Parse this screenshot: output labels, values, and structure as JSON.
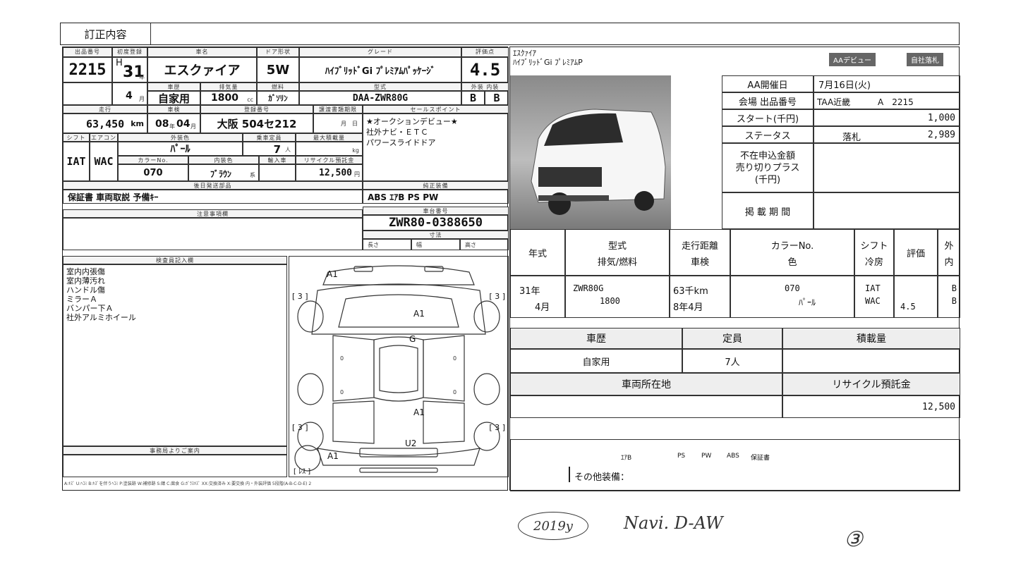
{
  "correction": {
    "label": "訂正内容",
    "value": ""
  },
  "sheet": {
    "lot_no_label": "出品番号",
    "lot_no": "2215",
    "first_reg_label": "初度登録",
    "era": "H",
    "year": "31",
    "year_unit": "年",
    "month": "4",
    "month_unit": "月",
    "car_name_label": "車名",
    "car_name": "エスクァイア",
    "door_label": "ドア形状",
    "door": "5W",
    "grade_label": "グレード",
    "grade": "ﾊｲﾌﾞﾘｯﾄﾞGi ﾌﾟﾚﾐｱﾑﾊﾟｯｹｰｼﾞ",
    "score_label": "評価点",
    "score": "4.5",
    "ext_int_label": "外装 内装",
    "ext_grade": "B",
    "int_grade": "B",
    "history_label": "車歴",
    "history": "自家用",
    "displacement_label": "排気量",
    "displacement": "1800",
    "cc": "cc",
    "fuel_label": "燃料",
    "fuel": "ｶﾞｿﾘﾝ",
    "model_label": "型式",
    "model": "DAA-ZWR80G",
    "mileage_label": "走行",
    "mileage": "63,450",
    "km": "km",
    "inspection_label": "車検",
    "inspection": "08",
    "insp_year_unit": "年",
    "inspection_m": "04",
    "insp_month_unit": "月",
    "plate_label": "登録番号",
    "plate": "大阪 504セ212",
    "doc_expiry_label": "譲渡書類期限",
    "doc_expiry": "月　日",
    "sales_point_label": "セールスポイント",
    "sales_points": [
      "★オークションデビュー★",
      "社外ナビ・ＥＴＣ",
      "パワースライドドア"
    ],
    "shift_label": "シフト",
    "shift": "IAT",
    "ac_label": "エアコン",
    "ac": "WAC",
    "ext_color_label": "外装色",
    "ext_color": "ﾊﾟｰﾙ",
    "capacity_label": "乗車定員",
    "capacity": "7",
    "capacity_unit": "人",
    "max_load_label": "最大積載量",
    "max_load_unit": "kg",
    "color_no_label": "カラーNo.",
    "color_no": "070",
    "int_color_label": "内装色",
    "int_color": "ﾌﾞﾗｳﾝ",
    "int_color_unit": "系",
    "import_label": "輸入車",
    "recycle_label": "リサイクル預託金",
    "recycle": "12,500",
    "recycle_unit": "円",
    "parts_label": "後日発送部品",
    "parts": "保証書 車両取説 予備ｷｰ",
    "std_equip_label": "純正装備",
    "std_equip": "ABS ｴｱB PS PW",
    "notes_label": "注意事項欄",
    "chassis_label": "車台番号",
    "chassis": "ZWR80-0388650",
    "dims_label": "寸法",
    "len_label": "長さ",
    "width_label": "幅",
    "height_label": "高さ",
    "inspector_label": "検査員記入欄",
    "inspector_notes": [
      "室内内張傷",
      "室内薄汚れ",
      "ハンドル傷",
      "ミラーＡ",
      "バンパー下Ａ",
      "社外アルミホイール"
    ],
    "office_label": "事務局よりご案内",
    "legend": "A:ｷｽﾞ U:ﾍｺﾐ B:ｷｽﾞを伴うﾍｺﾐ P:塗装跡 W:補修跡 S:錆 C:腐食 G:ｶﾞﾗｽｷｽﾞ XX:交換済み X:要交換 内・外装評価 5段階(A-B-C-D-E) 2"
  },
  "diagram": {
    "a1_tl": "A1",
    "a1_mid": "A1",
    "g": "G",
    "a1_rear": "A1",
    "u2": "U2",
    "a1_bl": "A1",
    "b3_tl": "[ 3 ]",
    "b3_tr": "[ 3 ]",
    "b3_bl": "[ 3 ]",
    "b3_br": "[ 3 ]",
    "zero": "0",
    "spare": "[ ﾚｽ ]"
  },
  "summary": {
    "title_line1": "ｴｽｸｧｲｱ",
    "title_line2": "ﾊｲﾌﾞﾘｯﾄﾞGi ﾌﾟﾚﾐｱﾑP",
    "badge1": "AAデビュー",
    "badge2": "自社落札",
    "rows": [
      {
        "label": "AA開催日",
        "value": "7月16日(火)"
      },
      {
        "label": "会場 出品番号",
        "venue": "TAA近畿",
        "value": "A　2215"
      },
      {
        "label": "スタート(千円)",
        "value": "1,000"
      },
      {
        "label": "ステータス",
        "status": "落札",
        "value": "2,989"
      },
      {
        "label": "不在申込金額\n売り切りプラス\n(千円)",
        "value": ""
      },
      {
        "label": "掲 載 期 間",
        "value": ""
      }
    ],
    "spec_headers": {
      "year": "年式",
      "model": "型式",
      "model2": "排気/燃料",
      "mileage": "走行距離",
      "mileage2": "車検",
      "color": "カラーNo.",
      "color2": "色",
      "shift": "シフト",
      "shift2": "冷房",
      "score": "評価",
      "ext": "外",
      "int": "内"
    },
    "spec_values": {
      "year": "31年",
      "month": "4月",
      "model": "ZWR80G",
      "cc": "1800",
      "km": "63千km",
      "insp": "8年4月",
      "color_no": "070",
      "color": "ﾊﾟｰﾙ",
      "shift": "IAT",
      "ac": "WAC",
      "score": "4.5",
      "ext": "B",
      "int": "B"
    },
    "history_h": "車歴",
    "capacity_h": "定員",
    "load_h": "積載量",
    "history_v": "自家用",
    "capacity_v": "7人",
    "load_v": "",
    "location_h": "車両所在地",
    "recycle_h": "リサイクル預託金",
    "location_v": "",
    "recycle_v": "12,500",
    "equip": [
      "ｴｱB",
      "PS",
      "PW",
      "ABS",
      "保証書"
    ],
    "other_label": "その他装備："
  },
  "handwriting": {
    "year": "2019y",
    "note": "Navi. D-AW",
    "mark": "③"
  }
}
